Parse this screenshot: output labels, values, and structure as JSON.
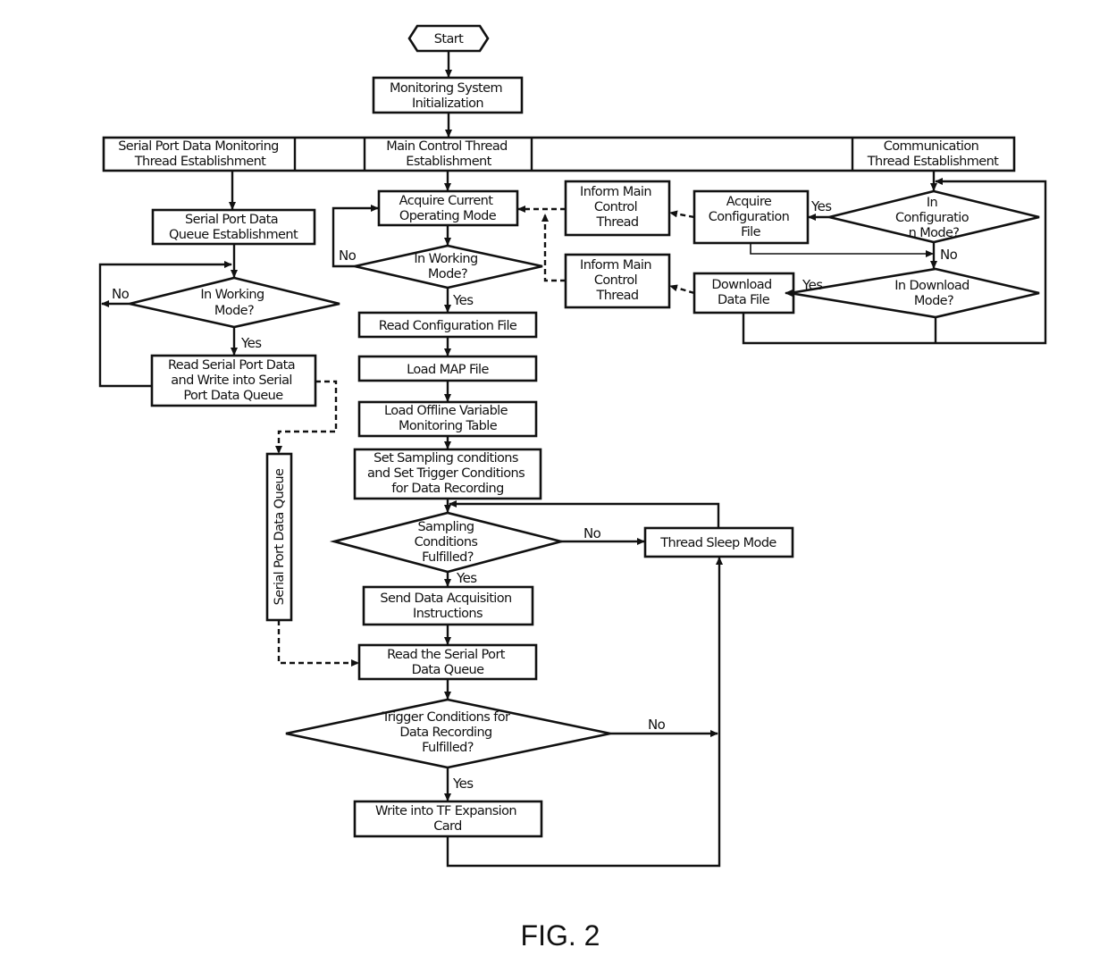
{
  "figure": {
    "caption": "FIG. 2"
  },
  "nodes": {
    "start": "Start",
    "init": [
      "Monitoring System",
      "Initialization"
    ],
    "serial_thread": [
      "Serial Port Data Monitoring",
      "Thread Establishment"
    ],
    "main_thread": [
      "Main Control Thread",
      "Establishment"
    ],
    "comm_thread": [
      "Communication",
      "Thread Establishment"
    ],
    "serial_queue_est": [
      "Serial Port Data",
      "Queue Establishment"
    ],
    "serial_working": [
      "In Working",
      "Mode?"
    ],
    "read_serial": [
      "Read Serial Port Data",
      "and Write into Serial",
      "Port Data Queue"
    ],
    "serial_queue": "Serial Port Data Queue",
    "acquire_mode": [
      "Acquire  Current",
      "Operating Mode"
    ],
    "main_working": [
      "In Working",
      "Mode?"
    ],
    "read_config": "Read Configuration File",
    "load_map": "Load MAP File",
    "load_offline": [
      "Load Offline Variable",
      "Monitoring Table"
    ],
    "set_conditions": [
      "Set Sampling conditions",
      "and Set Trigger Conditions",
      "for Data Recording"
    ],
    "sampling_fulfilled": [
      "Sampling",
      "Conditions",
      "Fulfilled?"
    ],
    "thread_sleep": "Thread Sleep Mode",
    "send_acq": [
      "Send Data Acquisition",
      "Instructions"
    ],
    "read_queue": [
      "Read the Serial Port",
      "Data Queue"
    ],
    "trigger_fulfilled": [
      "Trigger Conditions for",
      "Data Recording",
      "Fulfilled?"
    ],
    "write_tf": [
      "Write into TF Expansion",
      "Card"
    ],
    "inform_1": [
      "Inform Main",
      "Control",
      "Thread"
    ],
    "acquire_config": [
      "Acquire",
      "Configuration",
      "File"
    ],
    "config_mode": [
      "In",
      "Configuratio",
      "n Mode?"
    ],
    "inform_2": [
      "Inform Main",
      "Control",
      "Thread"
    ],
    "download_file": [
      "Download",
      "Data File"
    ],
    "download_mode": [
      "In Download",
      "Mode?"
    ]
  },
  "labels": {
    "yes": "Yes",
    "no": "No"
  }
}
